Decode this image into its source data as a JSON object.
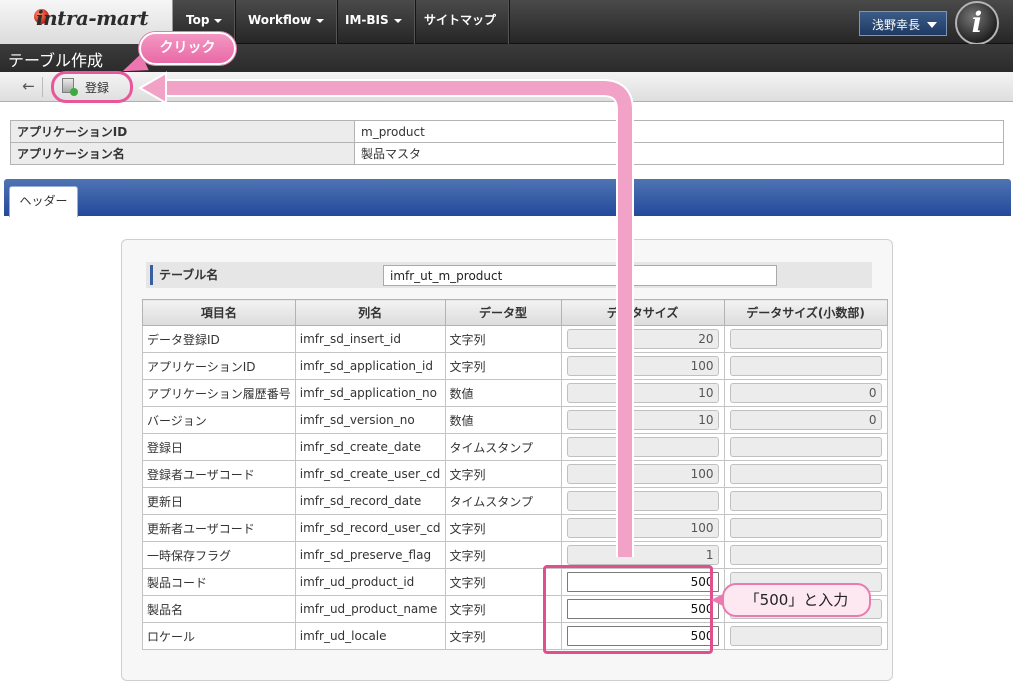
{
  "logo": {
    "text": "intra-mart"
  },
  "nav": {
    "items": [
      {
        "label": "Top",
        "dropdown": true
      },
      {
        "label": "Workflow",
        "dropdown": true
      },
      {
        "label": "IM-BIS",
        "dropdown": true
      },
      {
        "label": "サイトマップ",
        "dropdown": false
      }
    ],
    "user": "浅野幸長",
    "app_icon": "i"
  },
  "page": {
    "title": "テーブル作成"
  },
  "toolbar": {
    "back_icon": "←",
    "register_label": "登録"
  },
  "app_info": {
    "id_label": "アプリケーションID",
    "id_value": "m_product",
    "name_label": "アプリケーション名",
    "name_value": "製品マスタ"
  },
  "tabs": [
    {
      "label": "ヘッダー",
      "active": true
    }
  ],
  "table_name": {
    "label": "テーブル名",
    "value": "imfr_ut_m_product"
  },
  "columns": {
    "headers": [
      "項目名",
      "列名",
      "データ型",
      "データサイズ",
      "データサイズ(小数部)"
    ],
    "rows": [
      {
        "item": "データ登録ID",
        "column": "imfr_sd_insert_id",
        "type": "文字列",
        "size": "20",
        "decimal": "",
        "editable": false
      },
      {
        "item": "アプリケーションID",
        "column": "imfr_sd_application_id",
        "type": "文字列",
        "size": "100",
        "decimal": "",
        "editable": false
      },
      {
        "item": "アプリケーション履歴番号",
        "column": "imfr_sd_application_no",
        "type": "数値",
        "size": "10",
        "decimal": "0",
        "editable": false
      },
      {
        "item": "バージョン",
        "column": "imfr_sd_version_no",
        "type": "数値",
        "size": "10",
        "decimal": "0",
        "editable": false
      },
      {
        "item": "登録日",
        "column": "imfr_sd_create_date",
        "type": "タイムスタンプ",
        "size": "",
        "decimal": "",
        "editable": false
      },
      {
        "item": "登録者ユーザコード",
        "column": "imfr_sd_create_user_cd",
        "type": "文字列",
        "size": "100",
        "decimal": "",
        "editable": false
      },
      {
        "item": "更新日",
        "column": "imfr_sd_record_date",
        "type": "タイムスタンプ",
        "size": "",
        "decimal": "",
        "editable": false
      },
      {
        "item": "更新者ユーザコード",
        "column": "imfr_sd_record_user_cd",
        "type": "文字列",
        "size": "100",
        "decimal": "",
        "editable": false
      },
      {
        "item": "一時保存フラグ",
        "column": "imfr_sd_preserve_flag",
        "type": "文字列",
        "size": "1",
        "decimal": "",
        "editable": false
      },
      {
        "item": "製品コード",
        "column": "imfr_ud_product_id",
        "type": "文字列",
        "size": "500",
        "decimal": "",
        "editable": true
      },
      {
        "item": "製品名",
        "column": "imfr_ud_product_name",
        "type": "文字列",
        "size": "500",
        "decimal": "",
        "editable": true
      },
      {
        "item": "ロケール",
        "column": "imfr_ud_locale",
        "type": "文字列",
        "size": "500",
        "decimal": "",
        "editable": true
      }
    ]
  },
  "annotations": {
    "click_label": "クリック",
    "input_label": "「500」と入力",
    "color": "#e8579c"
  }
}
